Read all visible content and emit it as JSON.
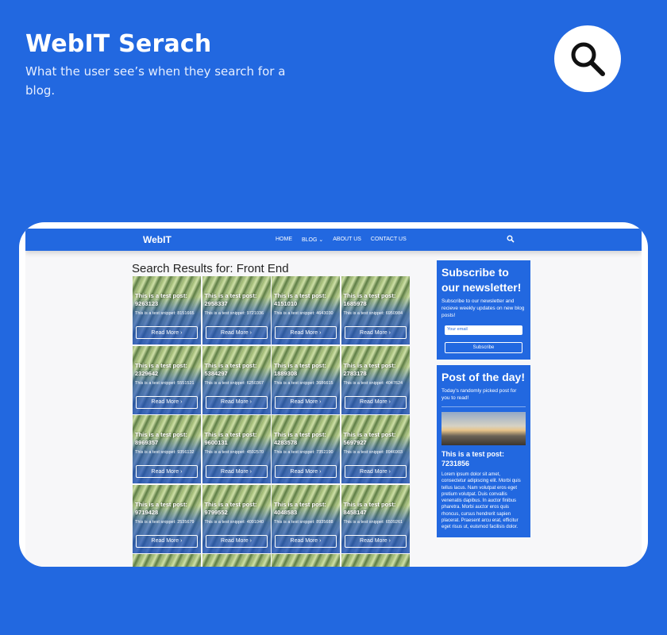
{
  "colors": {
    "brand_blue": "#2268e0",
    "white": "#ffffff"
  },
  "header": {
    "title": "WebIT Serach",
    "subtitle": "What the user see’s when they search for a blog.",
    "icon": "search-icon"
  },
  "site": {
    "brand": "WebIT",
    "nav": [
      "HOME",
      "BLOG ⌄",
      "ABOUT US",
      "CONTACT US"
    ],
    "search_icon": "search-icon",
    "results_title": "Search Results for: Front End",
    "read_more": "Read More ›",
    "cards": [
      {
        "title": "This is a test post: 9263123",
        "snippet": "This is a test snippet: 8151665"
      },
      {
        "title": "This is a test post: 2958337",
        "snippet": "This is a test snippet: 9721036"
      },
      {
        "title": "This is a test post: 4151010",
        "snippet": "This is a test snippet: 4643030"
      },
      {
        "title": "This is a test post: 1685978",
        "snippet": "This is a test snippet: 6950984"
      },
      {
        "title": "This is a test post: 2329642",
        "snippet": "This is a test snippet: 5551521"
      },
      {
        "title": "This is a test post: 5384297",
        "snippet": "This is a test snippet: 6250367"
      },
      {
        "title": "This is a test post: 1889308",
        "snippet": "This is a test snippet: 3686615"
      },
      {
        "title": "This is a test post: 2783178",
        "snippet": "This is a test snippet: 4047624"
      },
      {
        "title": "This is a test post: 8969357",
        "snippet": "This is a test snippet: 9356132"
      },
      {
        "title": "This is a test post: 9600131",
        "snippet": "This is a test snippet: 4592570"
      },
      {
        "title": "This is a test post: 4283578",
        "snippet": "This is a test snippet: 7352190"
      },
      {
        "title": "This is a test post: 5697927",
        "snippet": "This is a test snippet: 8946903"
      },
      {
        "title": "This is a test post: 9719428",
        "snippet": "This is a test snippet: 2535679"
      },
      {
        "title": "This is a test post: 9799552",
        "snippet": "This is a test snippet: 4091040"
      },
      {
        "title": "This is a test post: 4048583",
        "snippet": "This is a test snippet: 8935688"
      },
      {
        "title": "This is a test post: 8458147",
        "snippet": "This is a test snippet: 6509261"
      },
      {
        "title": "",
        "snippet": ""
      },
      {
        "title": "",
        "snippet": ""
      },
      {
        "title": "",
        "snippet": ""
      },
      {
        "title": "",
        "snippet": ""
      }
    ],
    "sidebar": {
      "subscribe": {
        "title": "Subscribe to our newsletter!",
        "text": "Subscribe to our newsletter and recieve weekly updates on new blog posts!",
        "email_placeholder": "Your email",
        "button": "Subscribe"
      },
      "potd": {
        "title": "Post of the day!",
        "text": "Today's randomly picked post for you to read!",
        "post_title": "This is a test post: 7231856",
        "body": "Lorem ipsum dolor sit amet, consectetur adipiscing elit. Morbi quis tellus lacus. Nam volutpat eros eget pretium volutpat. Duis convallis venenatis dapibus. In auctor finibus pharetra. Morbi auctor eros quis rhoncus, cursus hendrerit sapien placerat. Praesent arcu erat, efficitur eget risus ut, euismod facilisis dolor."
      }
    }
  }
}
